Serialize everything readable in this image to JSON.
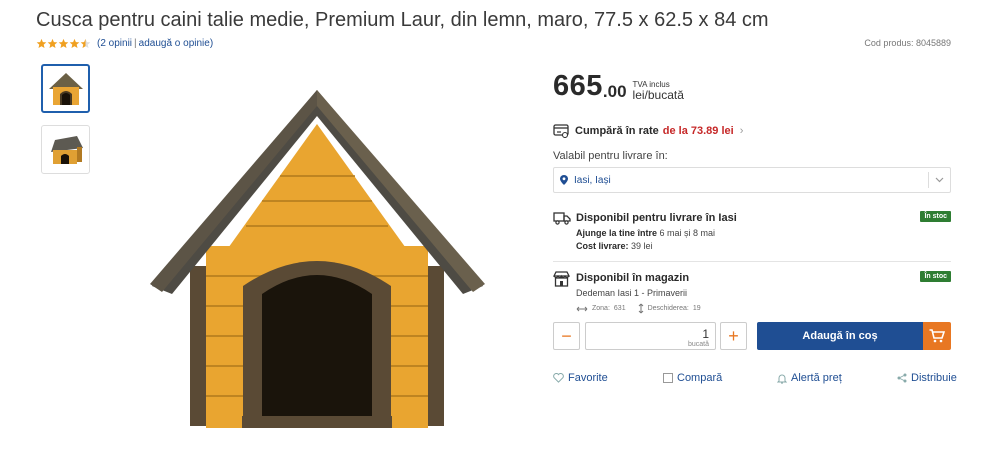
{
  "product": {
    "title": "Cusca pentru caini talie medie, Premium Laur, din lemn, maro, 77.5 x 62.5 x 84 cm",
    "rating_value": 4.5,
    "reviews_text": "(2 opinii",
    "add_review": "adaugă o opinie)",
    "code_label": "Cod produs: 8045889"
  },
  "price": {
    "integer": "665",
    "decimal": ".00",
    "tva": "TVA inclus",
    "unit": "lei/bucată"
  },
  "installments": {
    "label": "Cumpără în rate",
    "amount": "de la 73.89 lei"
  },
  "delivery": {
    "label": "Valabil pentru livrare în:",
    "city": "Iasi, Iași"
  },
  "availability_delivery": {
    "title": "Disponibil pentru livrare în Iasi",
    "arrives_label": "Ajunge la tine între",
    "arrives_value": "6 mai și 8 mai",
    "cost_label": "Cost livrare:",
    "cost_value": "39 lei",
    "badge": "În stoc"
  },
  "availability_store": {
    "title": "Disponibil în magazin",
    "store": "Dedeman Iasi 1 - Primaverii",
    "zone_label": "Zona:",
    "zone_value": "631",
    "opening_label": "Deschiderea:",
    "opening_value": "19",
    "badge": "În stoc"
  },
  "quantity": {
    "value": "1",
    "unit": "bucată",
    "minus": "−",
    "plus": "+"
  },
  "cart": {
    "label": "Adaugă în coș"
  },
  "actions": {
    "favorite": "Favorite",
    "compare": "Compară",
    "price_alert": "Alertă preț",
    "share": "Distribuie"
  },
  "colors": {
    "brand_blue": "#1f4e93",
    "accent_orange": "#e87722",
    "stock_green": "#2e7d32",
    "installment_red": "#c62828",
    "star": "#f0a020"
  },
  "icons": [
    "star-icon",
    "installments-icon",
    "location-pin-icon",
    "chevron-down-icon",
    "delivery-truck-icon",
    "store-icon",
    "zone-arrows-icon",
    "shelf-arrows-icon",
    "cart-icon",
    "heart-icon",
    "checkbox-icon",
    "bell-icon",
    "share-icon"
  ]
}
